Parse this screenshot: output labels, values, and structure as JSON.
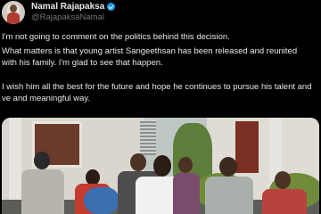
{
  "author": {
    "display_name": "Namal Rajapaksa",
    "handle": "@RajapaksaNamal"
  },
  "tweet": {
    "paragraph_1": "I'm not going to comment on the politics behind this decision.",
    "paragraph_2": "What matters is that young artist Sangeethsan has been released and reunited with his family. I'm glad to see that happen.",
    "paragraph_3": "I wish him all the best for the future and hope he continues to pursue his talent and ve and meaningful way."
  },
  "colors": {
    "background": "#000000",
    "text": "#e7e9ea",
    "secondary_text": "#71767b",
    "verified_badge": "#1d9bf0"
  },
  "icons": {
    "verified": "verified-badge-icon"
  }
}
